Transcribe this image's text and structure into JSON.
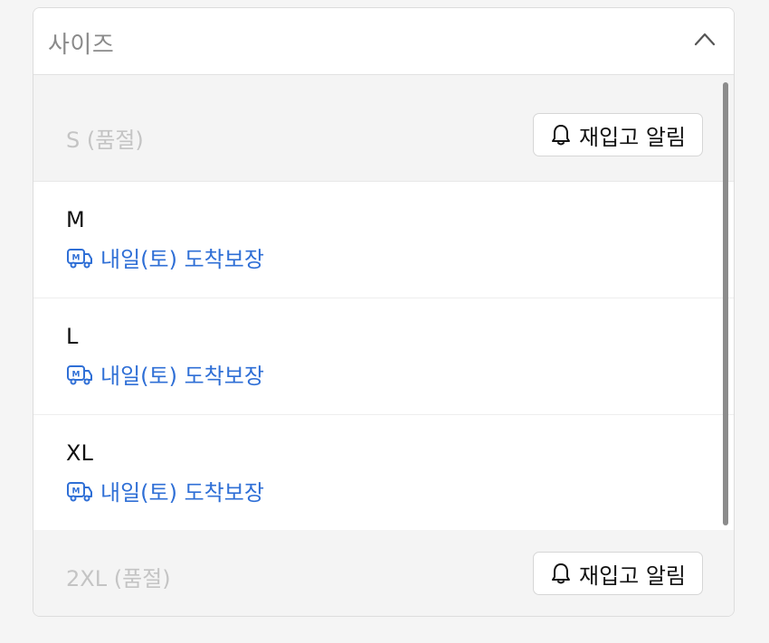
{
  "dropdown": {
    "label": "사이즈",
    "expanded": true
  },
  "options": [
    {
      "size": "S (품절)",
      "status": "soldout",
      "button": "재입고 알림"
    },
    {
      "size": "M",
      "status": "available",
      "delivery": "내일(토) 도착보장"
    },
    {
      "size": "L",
      "status": "available",
      "delivery": "내일(토) 도착보장"
    },
    {
      "size": "XL",
      "status": "available",
      "delivery": "내일(토) 도착보장"
    },
    {
      "size": "2XL (품절)",
      "status": "soldout",
      "button": "재입고 알림"
    }
  ],
  "icons": {
    "chevron": "chevron-up-icon",
    "delivery": "delivery-truck-icon",
    "bell": "bell-icon"
  },
  "colors": {
    "delivery_text": "#2f6fd6",
    "soldout_text": "#c4c4c4",
    "soldout_bg": "#f4f4f4"
  }
}
